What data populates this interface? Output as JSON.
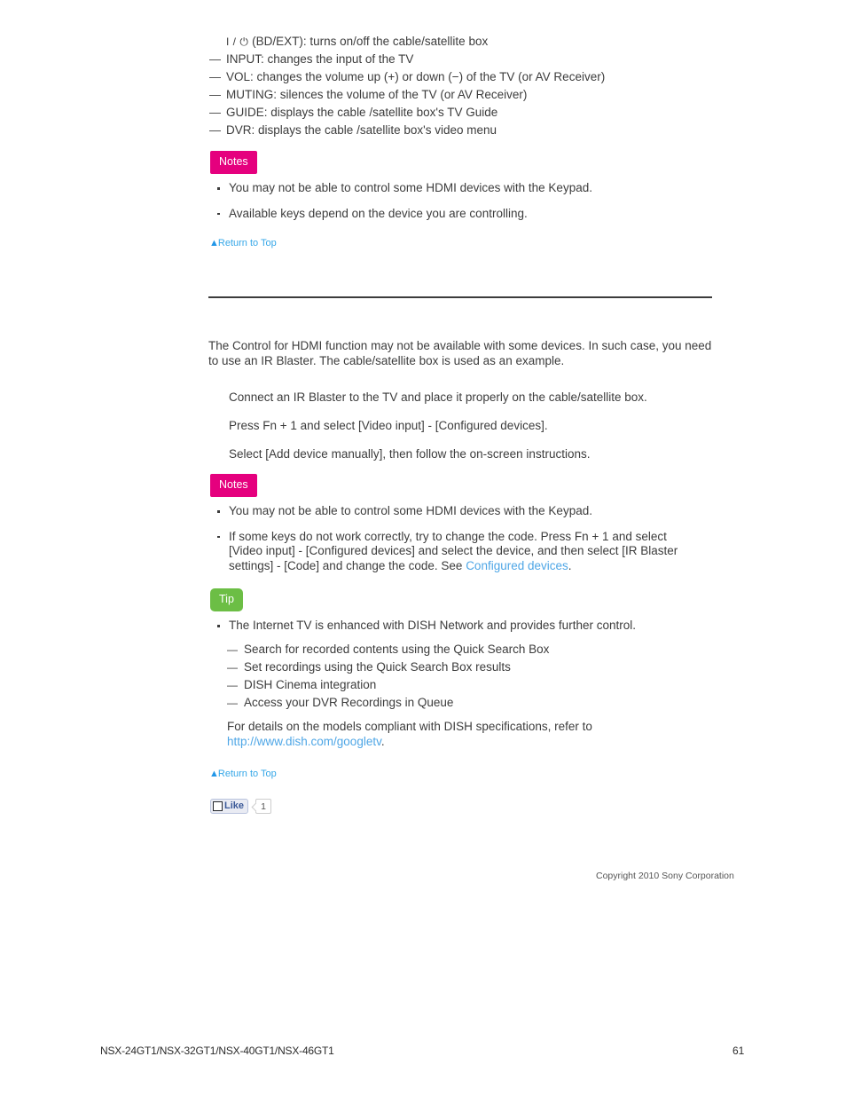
{
  "document": {
    "key_list": [
      {
        "marker": "none",
        "prefix": "I / ⏻",
        "text": " (BD/EXT): turns on/off the cable/satellite box"
      },
      {
        "marker": "dash",
        "prefix": "",
        "text": "INPUT: changes the input of the TV"
      },
      {
        "marker": "dash",
        "prefix": "",
        "text": "VOL: changes the volume up (+) or down (−) of the TV (or AV Receiver)"
      },
      {
        "marker": "dash",
        "prefix": "",
        "text": "MUTING: silences the volume of the TV (or AV Receiver)"
      },
      {
        "marker": "dash",
        "prefix": "",
        "text": "GUIDE: displays the cable /satellite box's TV Guide"
      },
      {
        "marker": "dash",
        "prefix": "",
        "text": "DVR: displays the cable /satellite box's video menu"
      }
    ],
    "notes_1": {
      "badge": "Notes",
      "items": [
        "You may not be able to control some HDMI devices with the Keypad.",
        "Available keys depend on the device you are controlling."
      ]
    },
    "return_to_top_1": {
      "triangle": "▲",
      "label": "Return to Top"
    },
    "intro_paragraph": "The Control for HDMI function may not be available with some devices. In such case, you need to use an IR Blaster. The cable/satellite box is used as an example.",
    "steps": [
      "Connect an IR Blaster to the TV and place it properly on the cable/satellite box.",
      "Press Fn + 1 and select [Video input] - [Configured devices].",
      "Select [Add device manually], then follow the on-screen instructions."
    ],
    "notes_2": {
      "badge": "Notes",
      "item_1": "You may not be able to control some HDMI devices with the Keypad.",
      "item_2_before": "If some keys do not work correctly, try to change the code. Press Fn + 1 and select [Video input] - [Configured devices] and select the device, and then select [IR Blaster settings] - [Code] and change the code. See ",
      "item_2_link": "Configured devices",
      "item_2_after": "."
    },
    "tip": {
      "badge": "Tip",
      "lead": "The Internet TV is enhanced with DISH Network and provides further control.",
      "sub_items": [
        "Search for recorded contents using the Quick Search Box",
        "Set recordings using the Quick Search Box results",
        "DISH Cinema integration",
        "Access your DVR Recordings in Queue"
      ],
      "detail_before": "For details on the models compliant with DISH specifications, refer to",
      "detail_link": "http://www.dish.com/googletv",
      "detail_after": "."
    },
    "return_to_top_2": {
      "triangle": "▲",
      "label": "Return to Top"
    },
    "social": {
      "like_label": "Like",
      "like_count": "1"
    },
    "copyright": "Copyright 2010 Sony Corporation",
    "footer": {
      "models": "NSX-24GT1/NSX-32GT1/NSX-40GT1/NSX-46GT1",
      "page_number": "61"
    }
  },
  "colors": {
    "notes_badge": "#e5007e",
    "tip_badge": "#6cbe45",
    "link": "#4ea6e6",
    "return_link": "#35a7e8",
    "text": "#3c3c3c"
  }
}
